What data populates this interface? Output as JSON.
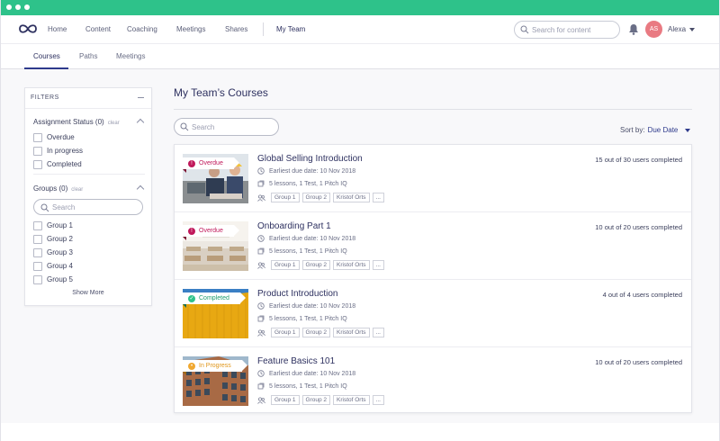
{
  "colors": {
    "titlebar": "#2ec28a",
    "brand_navy": "#2e3160",
    "overdue": "#c0185a",
    "completed": "#2ec28a",
    "in_progress": "#f0a830",
    "avatar": "#e97a82"
  },
  "topnav": {
    "logo_icon": "infinity-logo-icon",
    "links": [
      "Home",
      "Content",
      "Coaching",
      "Meetings",
      "Shares",
      "My Team"
    ],
    "active": "My Team",
    "search_placeholder": "Search for content",
    "avatar_initials": "AS",
    "user_name": "Alexa"
  },
  "subnav": {
    "tabs": [
      "Courses",
      "Paths",
      "Meetings"
    ],
    "active": "Courses"
  },
  "filters": {
    "header": "FILTERS",
    "assignment": {
      "title": "Assignment Status (0)",
      "clear": "clear",
      "options": [
        "Overdue",
        "In progress",
        "Completed"
      ]
    },
    "groups": {
      "title": "Groups (0)",
      "clear": "clear",
      "search_placeholder": "Search",
      "options": [
        "Group 1",
        "Group 2",
        "Group 3",
        "Group 4",
        "Group 5"
      ],
      "show_more": "Show More"
    }
  },
  "main": {
    "title": "My Team’s Courses",
    "search_placeholder": "Search",
    "sort_label": "Sort by:",
    "sort_value": "Due Date"
  },
  "courses": [
    {
      "status": "Overdue",
      "status_kind": "overdue",
      "title": "Global Selling Introduction",
      "due": "Earliest due date: 10 Nov 2018",
      "lessons": "5 lessons, 1 Test, 1 Pitch IQ",
      "tags": [
        "Group 1",
        "Group 2",
        "Kristof Orts",
        "..."
      ],
      "completed": "15 out of 30 users completed"
    },
    {
      "status": "Overdue",
      "status_kind": "overdue",
      "title": "Onboarding Part 1",
      "due": "Earliest due date: 10 Nov 2018",
      "lessons": "5 lessons, 1 Test, 1 Pitch IQ",
      "tags": [
        "Group 1",
        "Group 2",
        "Kristof Orts",
        "..."
      ],
      "completed": "10 out of 20 users completed"
    },
    {
      "status": "Completed",
      "status_kind": "completed",
      "title": "Product Introduction",
      "due": "Earliest due date: 10 Nov 2018",
      "lessons": "5 lessons, 1 Test, 1 Pitch IQ",
      "tags": [
        "Group 1",
        "Group 2",
        "Kristof Orts",
        "..."
      ],
      "completed": "4 out of 4 users completed"
    },
    {
      "status": "In Progress",
      "status_kind": "in_progress",
      "title": "Feature Basics 101",
      "due": "Earliest due date: 10 Nov 2018",
      "lessons": "5 lessons, 1 Test, 1 Pitch IQ",
      "tags": [
        "Group 1",
        "Group 2",
        "Kristof Orts",
        "..."
      ],
      "completed": "10 out of 20 users completed"
    }
  ]
}
